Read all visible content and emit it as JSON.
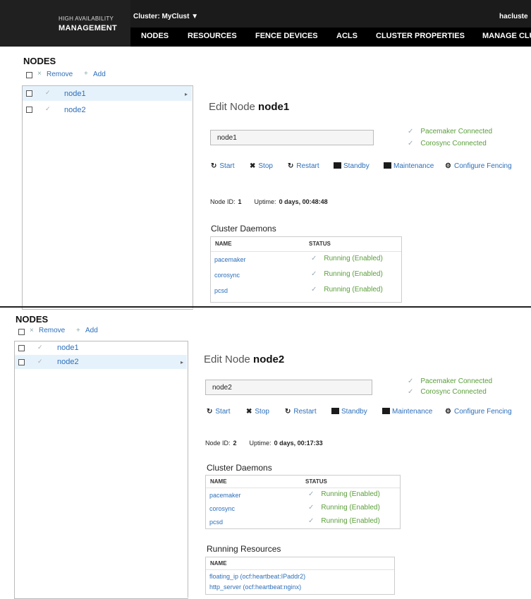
{
  "header": {
    "brand_line1": "HIGH AVAILABILITY",
    "brand_line2": "MANAGEMENT",
    "cluster_selector": "Cluster: MyClust ▼",
    "user": "hacluste",
    "menu": [
      "NODES",
      "RESOURCES",
      "FENCE DEVICES",
      "ACLS",
      "CLUSTER PROPERTIES",
      "MANAGE CLU"
    ]
  },
  "panel1": {
    "title": "NODES",
    "remove_label": "Remove",
    "add_label": "Add",
    "nodes": [
      "node1",
      "node2"
    ],
    "edit_prefix": "Edit Node",
    "edit_node": "node1",
    "node_name_value": "node1",
    "pacemaker_status": "Pacemaker Connected",
    "corosync_status": "Corosync Connected",
    "actions": [
      "Start",
      "Stop",
      "Restart",
      "Standby",
      "Maintenance",
      "Configure Fencing"
    ],
    "node_id_label": "Node ID:",
    "node_id": "1",
    "uptime_label": "Uptime:",
    "uptime": "0 days, 00:48:48",
    "daemons_title": "Cluster Daemons",
    "daemons_headers": [
      "NAME",
      "STATUS"
    ],
    "daemons": [
      {
        "name": "pacemaker",
        "status": "Running (Enabled)"
      },
      {
        "name": "corosync",
        "status": "Running (Enabled)"
      },
      {
        "name": "pcsd",
        "status": "Running (Enabled)"
      }
    ]
  },
  "panel2": {
    "title": "NODES",
    "remove_label": "Remove",
    "add_label": "Add",
    "nodes": [
      "node1",
      "node2"
    ],
    "edit_prefix": "Edit Node",
    "edit_node": "node2",
    "node_name_value": "node2",
    "pacemaker_status": "Pacemaker Connected",
    "corosync_status": "Corosync Connected",
    "actions": [
      "Start",
      "Stop",
      "Restart",
      "Standby",
      "Maintenance",
      "Configure Fencing"
    ],
    "node_id_label": "Node ID:",
    "node_id": "2",
    "uptime_label": "Uptime:",
    "uptime": "0 days, 00:17:33",
    "daemons_title": "Cluster Daemons",
    "daemons_headers": [
      "NAME",
      "STATUS"
    ],
    "daemons": [
      {
        "name": "pacemaker",
        "status": "Running (Enabled)"
      },
      {
        "name": "corosync",
        "status": "Running (Enabled)"
      },
      {
        "name": "pcsd",
        "status": "Running (Enabled)"
      }
    ],
    "resources_title": "Running Resources",
    "resources_header": "NAME",
    "resources": [
      "floating_ip (ocf:heartbeat:IPaddr2)",
      "http_server (ocf:heartbeat:nginx)"
    ]
  },
  "icons": {
    "tick": "✓",
    "remove": "×",
    "add": "+",
    "arrow": "▸",
    "start": "↻",
    "stop": "✖",
    "restart": "↻",
    "fencing": "⚙"
  },
  "colors": {
    "link": "#2d6fba",
    "ok": "#5a9e3a",
    "header": "#1b1b1b",
    "selected_row": "#e6f2fb"
  }
}
